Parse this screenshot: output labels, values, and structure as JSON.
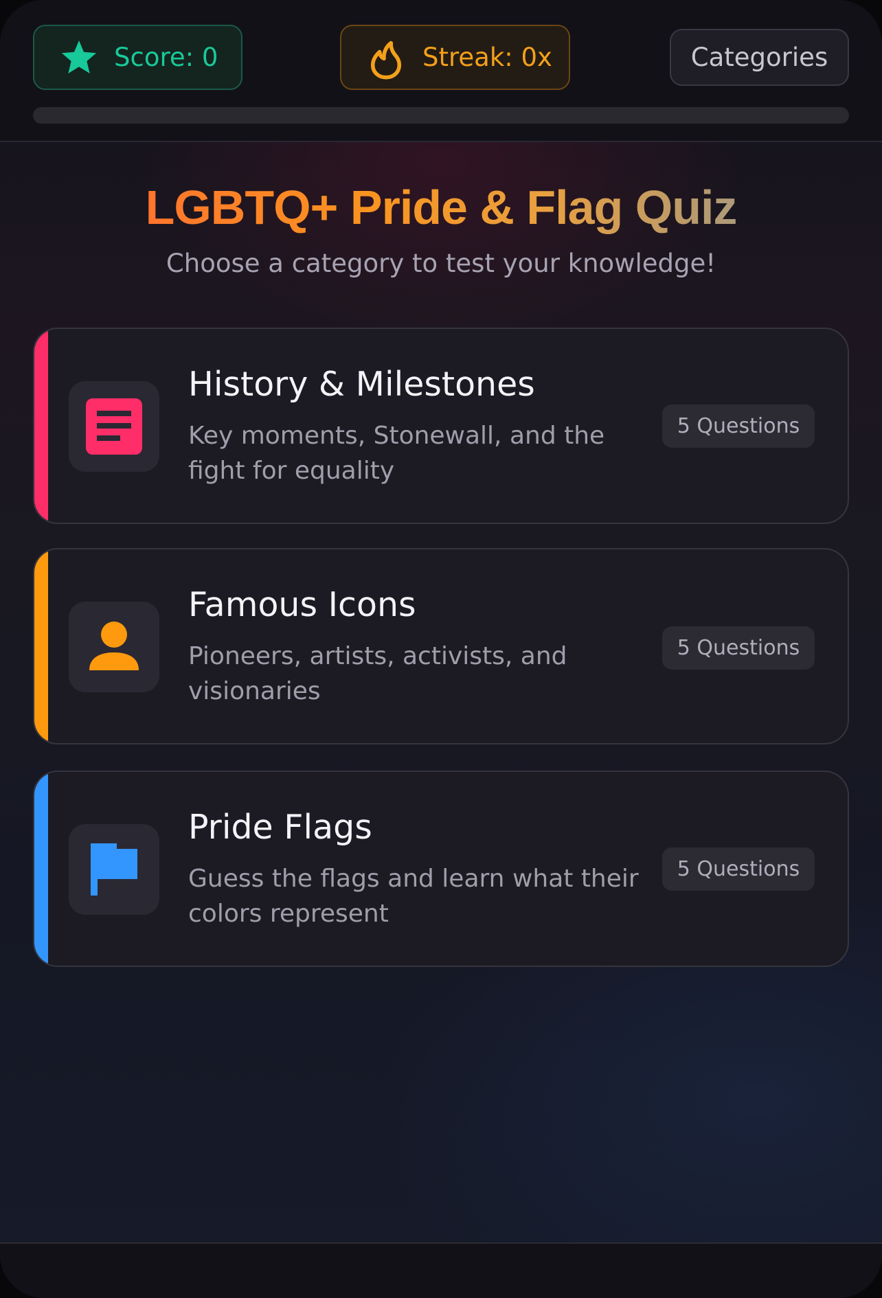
{
  "header": {
    "score_label": "Score: 0",
    "streak_label": "Streak: 0x",
    "categories_label": "Categories",
    "progress_fraction": 0
  },
  "main": {
    "title": "LGBTQ+ Pride & Flag Quiz",
    "subtitle": "Choose a category to test your knowledge!"
  },
  "categories": [
    {
      "title": "History & Milestones",
      "description": "Key moments, Stonewall, and the fight for equality",
      "badge": "5 Questions",
      "icon": "document-icon",
      "accent_color": "#ff2d68"
    },
    {
      "title": "Famous Icons",
      "description": "Pioneers, artists, activists, and visionaries",
      "badge": "5 Questions",
      "icon": "person-icon",
      "accent_color": "#ff9a0e"
    },
    {
      "title": "Pride Flags",
      "description": "Guess the flags and learn what their colors represent",
      "badge": "5 Questions",
      "icon": "flag-icon",
      "accent_color": "#3396ff"
    }
  ],
  "colors": {
    "score": "#18c999",
    "streak": "#f4a01b"
  }
}
